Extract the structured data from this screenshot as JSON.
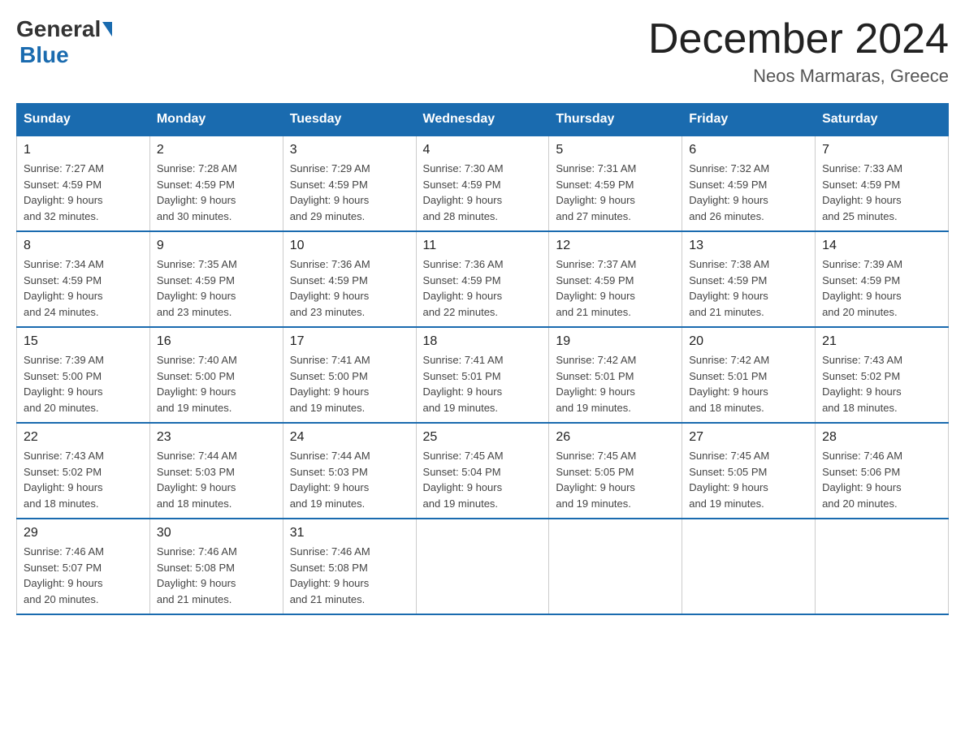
{
  "header": {
    "logo_general": "General",
    "logo_blue": "Blue",
    "month_title": "December 2024",
    "location": "Neos Marmaras, Greece"
  },
  "days_of_week": [
    "Sunday",
    "Monday",
    "Tuesday",
    "Wednesday",
    "Thursday",
    "Friday",
    "Saturday"
  ],
  "weeks": [
    [
      {
        "day": "1",
        "sunrise": "7:27 AM",
        "sunset": "4:59 PM",
        "daylight": "9 hours and 32 minutes."
      },
      {
        "day": "2",
        "sunrise": "7:28 AM",
        "sunset": "4:59 PM",
        "daylight": "9 hours and 30 minutes."
      },
      {
        "day": "3",
        "sunrise": "7:29 AM",
        "sunset": "4:59 PM",
        "daylight": "9 hours and 29 minutes."
      },
      {
        "day": "4",
        "sunrise": "7:30 AM",
        "sunset": "4:59 PM",
        "daylight": "9 hours and 28 minutes."
      },
      {
        "day": "5",
        "sunrise": "7:31 AM",
        "sunset": "4:59 PM",
        "daylight": "9 hours and 27 minutes."
      },
      {
        "day": "6",
        "sunrise": "7:32 AM",
        "sunset": "4:59 PM",
        "daylight": "9 hours and 26 minutes."
      },
      {
        "day": "7",
        "sunrise": "7:33 AM",
        "sunset": "4:59 PM",
        "daylight": "9 hours and 25 minutes."
      }
    ],
    [
      {
        "day": "8",
        "sunrise": "7:34 AM",
        "sunset": "4:59 PM",
        "daylight": "9 hours and 24 minutes."
      },
      {
        "day": "9",
        "sunrise": "7:35 AM",
        "sunset": "4:59 PM",
        "daylight": "9 hours and 23 minutes."
      },
      {
        "day": "10",
        "sunrise": "7:36 AM",
        "sunset": "4:59 PM",
        "daylight": "9 hours and 23 minutes."
      },
      {
        "day": "11",
        "sunrise": "7:36 AM",
        "sunset": "4:59 PM",
        "daylight": "9 hours and 22 minutes."
      },
      {
        "day": "12",
        "sunrise": "7:37 AM",
        "sunset": "4:59 PM",
        "daylight": "9 hours and 21 minutes."
      },
      {
        "day": "13",
        "sunrise": "7:38 AM",
        "sunset": "4:59 PM",
        "daylight": "9 hours and 21 minutes."
      },
      {
        "day": "14",
        "sunrise": "7:39 AM",
        "sunset": "4:59 PM",
        "daylight": "9 hours and 20 minutes."
      }
    ],
    [
      {
        "day": "15",
        "sunrise": "7:39 AM",
        "sunset": "5:00 PM",
        "daylight": "9 hours and 20 minutes."
      },
      {
        "day": "16",
        "sunrise": "7:40 AM",
        "sunset": "5:00 PM",
        "daylight": "9 hours and 19 minutes."
      },
      {
        "day": "17",
        "sunrise": "7:41 AM",
        "sunset": "5:00 PM",
        "daylight": "9 hours and 19 minutes."
      },
      {
        "day": "18",
        "sunrise": "7:41 AM",
        "sunset": "5:01 PM",
        "daylight": "9 hours and 19 minutes."
      },
      {
        "day": "19",
        "sunrise": "7:42 AM",
        "sunset": "5:01 PM",
        "daylight": "9 hours and 19 minutes."
      },
      {
        "day": "20",
        "sunrise": "7:42 AM",
        "sunset": "5:01 PM",
        "daylight": "9 hours and 18 minutes."
      },
      {
        "day": "21",
        "sunrise": "7:43 AM",
        "sunset": "5:02 PM",
        "daylight": "9 hours and 18 minutes."
      }
    ],
    [
      {
        "day": "22",
        "sunrise": "7:43 AM",
        "sunset": "5:02 PM",
        "daylight": "9 hours and 18 minutes."
      },
      {
        "day": "23",
        "sunrise": "7:44 AM",
        "sunset": "5:03 PM",
        "daylight": "9 hours and 18 minutes."
      },
      {
        "day": "24",
        "sunrise": "7:44 AM",
        "sunset": "5:03 PM",
        "daylight": "9 hours and 19 minutes."
      },
      {
        "day": "25",
        "sunrise": "7:45 AM",
        "sunset": "5:04 PM",
        "daylight": "9 hours and 19 minutes."
      },
      {
        "day": "26",
        "sunrise": "7:45 AM",
        "sunset": "5:05 PM",
        "daylight": "9 hours and 19 minutes."
      },
      {
        "day": "27",
        "sunrise": "7:45 AM",
        "sunset": "5:05 PM",
        "daylight": "9 hours and 19 minutes."
      },
      {
        "day": "28",
        "sunrise": "7:46 AM",
        "sunset": "5:06 PM",
        "daylight": "9 hours and 20 minutes."
      }
    ],
    [
      {
        "day": "29",
        "sunrise": "7:46 AM",
        "sunset": "5:07 PM",
        "daylight": "9 hours and 20 minutes."
      },
      {
        "day": "30",
        "sunrise": "7:46 AM",
        "sunset": "5:08 PM",
        "daylight": "9 hours and 21 minutes."
      },
      {
        "day": "31",
        "sunrise": "7:46 AM",
        "sunset": "5:08 PM",
        "daylight": "9 hours and 21 minutes."
      },
      null,
      null,
      null,
      null
    ]
  ],
  "labels": {
    "sunrise": "Sunrise:",
    "sunset": "Sunset:",
    "daylight": "Daylight:"
  }
}
